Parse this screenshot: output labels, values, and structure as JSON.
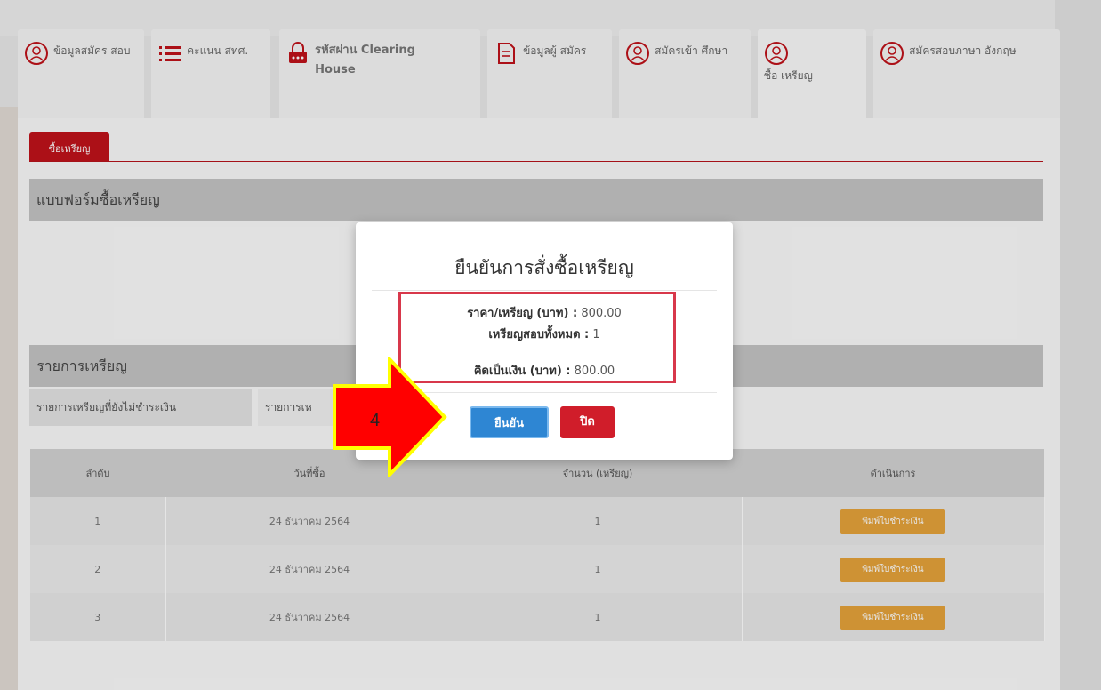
{
  "tabs": [
    {
      "label": "ข้อมูลสมัคร สอบ",
      "icon": "register-icon"
    },
    {
      "label": "คะแนน สทศ.",
      "icon": "list-icon"
    },
    {
      "label": "รหัสผ่าน Clearing House",
      "icon": "lock-icon"
    },
    {
      "label": "ข้อมูลผู้ สมัคร",
      "icon": "document-icon"
    },
    {
      "label": "สมัครเข้า ศึกษา",
      "icon": "register-icon"
    },
    {
      "label": "ซื้อ เหรียญ",
      "icon": "register-icon"
    },
    {
      "label": "สมัครสอบภาษา อังกฤษ",
      "icon": "register-icon"
    }
  ],
  "sub_tab": "ซื้อเหรียญ",
  "form_header": "แบบฟอร์มซื้อเหรียญ",
  "list_header": "รายการเหรียญ",
  "filter_tabs": [
    "รายการเหรียญที่ยังไม่ชำระเงิน",
    "รายการเห"
  ],
  "table": {
    "headers": [
      "ลำดับ",
      "วันที่ซื้อ",
      "จำนวน (เหรียญ)",
      "ดำเนินการ"
    ],
    "rows": [
      {
        "no": "1",
        "date": "24 ธันวาคม 2564",
        "qty": "1",
        "action": "พิมพ์ใบชำระเงิน"
      },
      {
        "no": "2",
        "date": "24 ธันวาคม 2564",
        "qty": "1",
        "action": "พิมพ์ใบชำระเงิน"
      },
      {
        "no": "3",
        "date": "24 ธันวาคม 2564",
        "qty": "1",
        "action": "พิมพ์ใบชำระเงิน"
      }
    ]
  },
  "modal": {
    "title": "ยืนยันการสั่งซื้อเหรียญ",
    "price_label": "ราคา/เหรียญ (บาท) :",
    "price_value": "800.00",
    "coins_label": "เหรียญสอบทั้งหมด :",
    "coins_value": "1",
    "total_label": "คิดเป็นเงิน (บาท) :",
    "total_value": "800.00",
    "confirm": "ยืนยัน",
    "close": "ปิด"
  },
  "annotation": {
    "step": "4",
    "color": "#ff0000",
    "outline": "#ffff00"
  },
  "colors": {
    "brand_red": "#c0121a",
    "confirm_blue": "#2e86d3",
    "print_orange": "#e6a33a"
  }
}
